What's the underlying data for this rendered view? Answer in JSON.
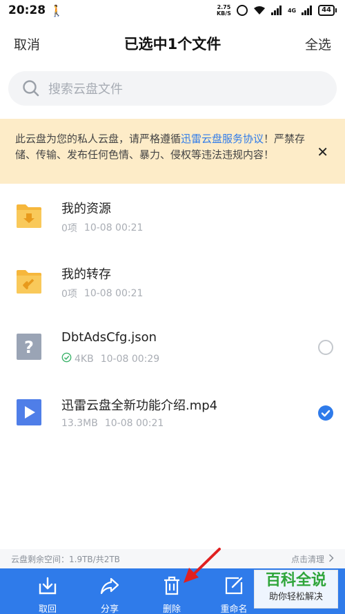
{
  "status_bar": {
    "time": "20:28",
    "speed_value": "2.75",
    "speed_unit": "KB/S",
    "network": "4G",
    "battery": "44"
  },
  "header": {
    "cancel_label": "取消",
    "title": "已选中1个文件",
    "select_all_label": "全选"
  },
  "search": {
    "placeholder": "搜索云盘文件"
  },
  "notice": {
    "text_before": "此云盘为您的私人云盘，请严格遵循",
    "link_text": "迅雷云盘服务协议",
    "text_after": "！严禁存储、传输、发布任何色情、暴力、侵权等违法违规内容！"
  },
  "files": [
    {
      "name": "我的资源",
      "size": "0项",
      "date": "10-08 00:21",
      "type": "folder-download",
      "selectable": false,
      "checked": false,
      "synced": false
    },
    {
      "name": "我的转存",
      "size": "0项",
      "date": "10-08 00:21",
      "type": "folder-transfer",
      "selectable": false,
      "checked": false,
      "synced": false
    },
    {
      "name": "DbtAdsCfg.json",
      "size": "4KB",
      "date": "10-08 00:29",
      "type": "unknown",
      "selectable": true,
      "checked": false,
      "synced": true
    },
    {
      "name": "迅雷云盘全新功能介绍.mp4",
      "size": "13.3MB",
      "date": "10-08 00:21",
      "type": "video",
      "selectable": true,
      "checked": true,
      "synced": false
    }
  ],
  "storage": {
    "text": "云盘剩余空间：1.9TB/共2TB",
    "clean_label": "点击清理"
  },
  "toolbar": {
    "items": [
      {
        "label": "取回",
        "icon": "retrieve-icon"
      },
      {
        "label": "分享",
        "icon": "share-icon"
      },
      {
        "label": "删除",
        "icon": "delete-icon"
      },
      {
        "label": "重命名",
        "icon": "rename-icon"
      }
    ]
  },
  "watermark": {
    "main": "百科全说",
    "sub": "助你轻松解决"
  },
  "colors": {
    "accent": "#2f7bea",
    "folder": "#f6b73c",
    "notice_bg": "#fdecc8",
    "arrow": "#e02020"
  }
}
